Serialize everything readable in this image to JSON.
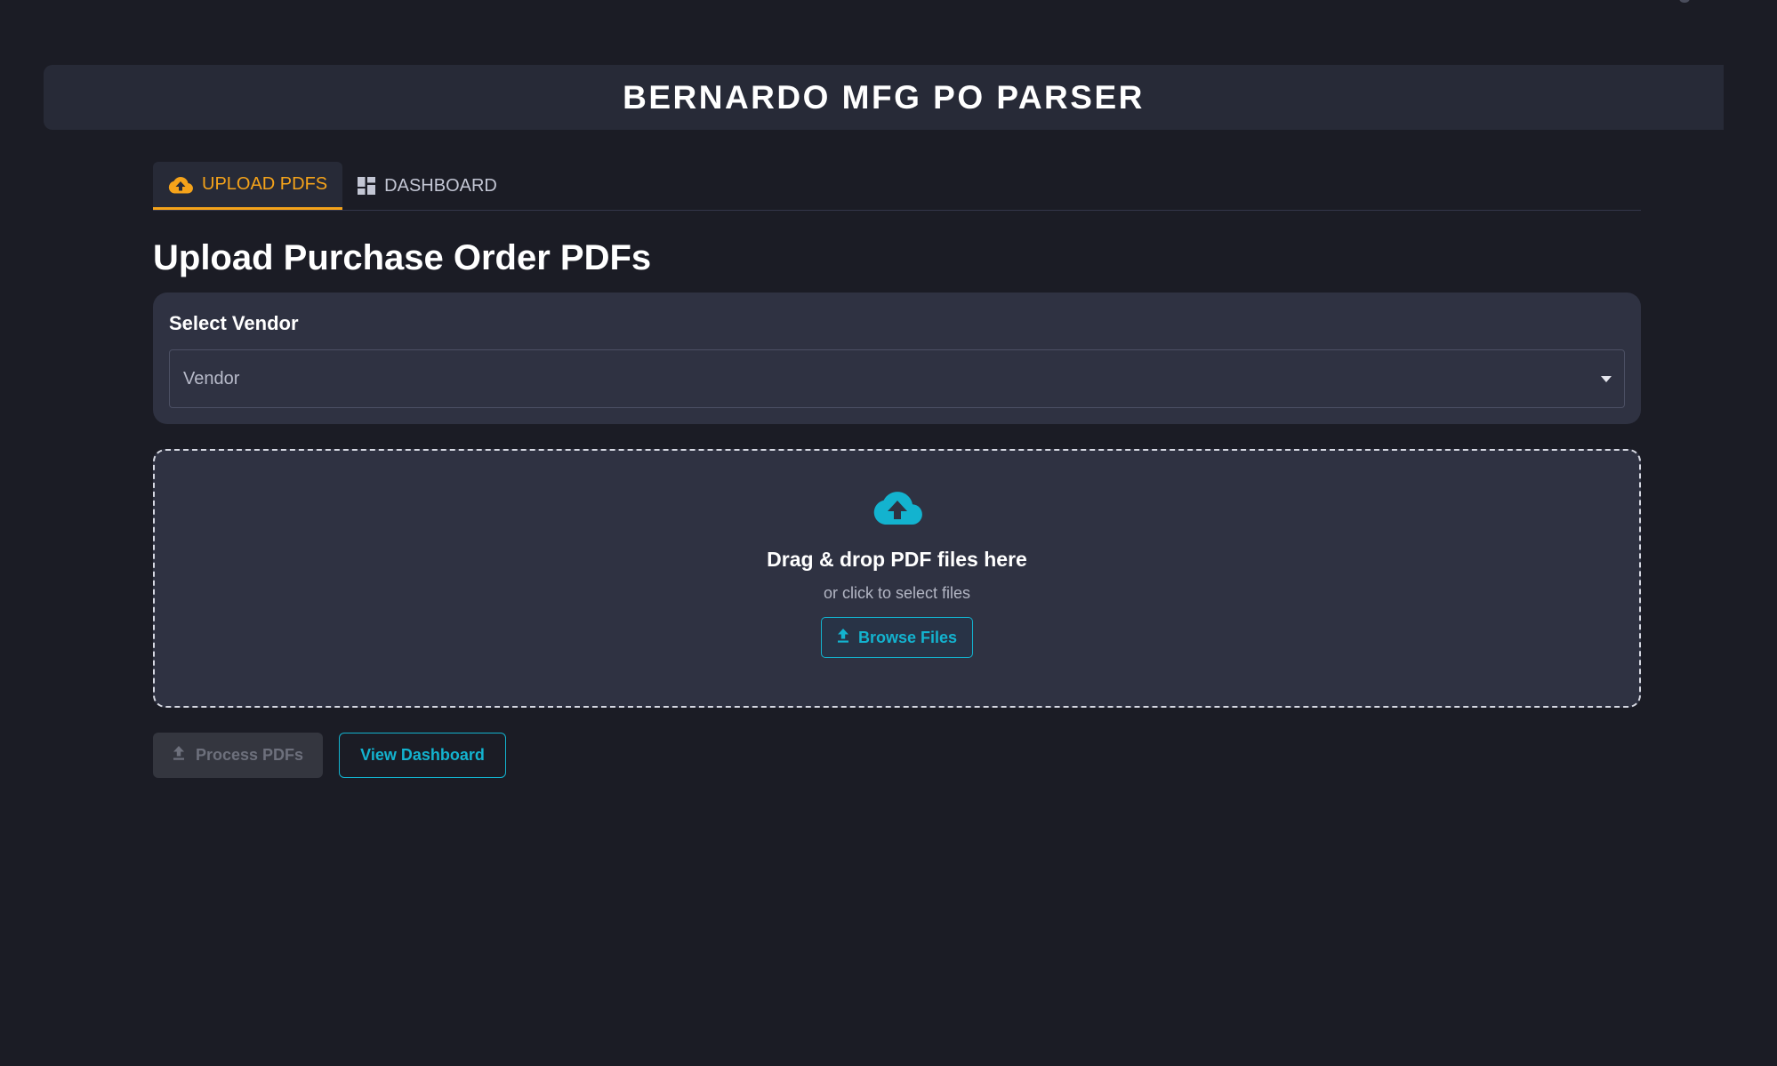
{
  "header": {
    "title": "BERNARDO MFG PO PARSER"
  },
  "tabs": [
    {
      "label": "UPLOAD PDFS",
      "icon": "cloud-upload-icon",
      "active": true
    },
    {
      "label": "DASHBOARD",
      "icon": "dashboard-icon",
      "active": false
    }
  ],
  "main": {
    "page_title": "Upload Purchase Order PDFs",
    "vendor": {
      "label": "Select Vendor",
      "placeholder": "Vendor",
      "icon": "caret-down-icon"
    },
    "dropzone": {
      "icon": "cloud-upload-icon",
      "title": "Drag & drop PDF files here",
      "subtitle": "or click to select files",
      "browse_label": "Browse Files",
      "browse_icon": "upload-icon"
    },
    "actions": {
      "process_label": "Process PDFs",
      "process_icon": "upload-icon",
      "process_disabled": true,
      "dashboard_label": "View Dashboard"
    }
  },
  "colors": {
    "background": "#1b1c25",
    "panel": "#2f3242",
    "header": "#272a37",
    "accent_orange": "#f5a31a",
    "accent_cyan": "#13b3cf",
    "disabled": "#34363f"
  }
}
